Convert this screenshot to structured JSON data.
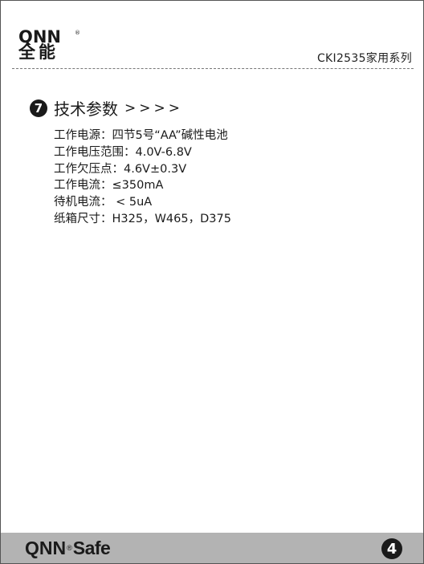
{
  "header": {
    "logo_en": "QNN",
    "logo_reg": "®",
    "logo_cn": "全能",
    "model_series": "CKI2535家用系列"
  },
  "section": {
    "number": "7",
    "title": "技术参数",
    "arrows": ">>>>",
    "specs": [
      "工作电源：四节5号“AA”碱性电池",
      "工作电压范围：4.0V-6.8V",
      "工作欠压点：4.6V±0.3V",
      "工作电流：≤350mA",
      "待机电流： < 5uA",
      "纸箱尺寸：H325，W465，D375"
    ]
  },
  "footer": {
    "brand": "QNN",
    "reg": "®",
    "safe": "Safe",
    "page_number": "4"
  }
}
